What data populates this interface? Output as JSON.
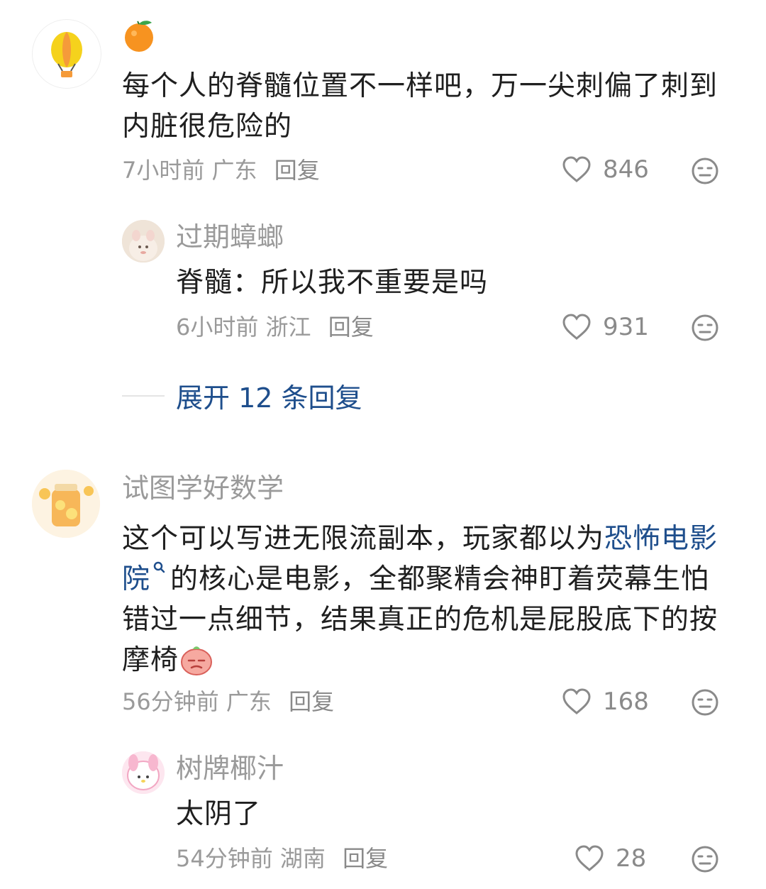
{
  "comments": [
    {
      "username": "",
      "content": "每个人的脊髓位置不一样吧，万一尖刺偏了刺到内脏很危险的",
      "time": "7小时前",
      "location": "广东",
      "reply_label": "回复",
      "likes": "846"
    },
    {
      "username": "过期蟑螂",
      "content": "脊髓：所以我不重要是吗",
      "time": "6小时前",
      "location": "浙江",
      "reply_label": "回复",
      "likes": "931"
    },
    {
      "username": "试图学好数学",
      "content_part1": "这个可以写进无限流副本，玩家都以为",
      "content_link": "恐怖电影院",
      "content_part2": "的核心是电影，全都聚精会神盯着荧幕生怕错过一点细节，结果真正的危机是屁股底下的按摩椅",
      "time": "56分钟前",
      "location": "广东",
      "reply_label": "回复",
      "likes": "168"
    },
    {
      "username": "树牌椰汁",
      "content": "太阴了",
      "time": "54分钟前",
      "location": "湖南",
      "reply_label": "回复",
      "likes": "28"
    }
  ],
  "expand_replies": "展开 12 条回复",
  "colors": {
    "link": "#1e4e8c",
    "meta": "#9a9a9a",
    "text": "#1f1f1f"
  },
  "icons": [
    "balloon-avatar-icon",
    "orange-icon",
    "heart-icon",
    "dislike-face-icon",
    "search-small-icon",
    "blush-face-emoji"
  ]
}
